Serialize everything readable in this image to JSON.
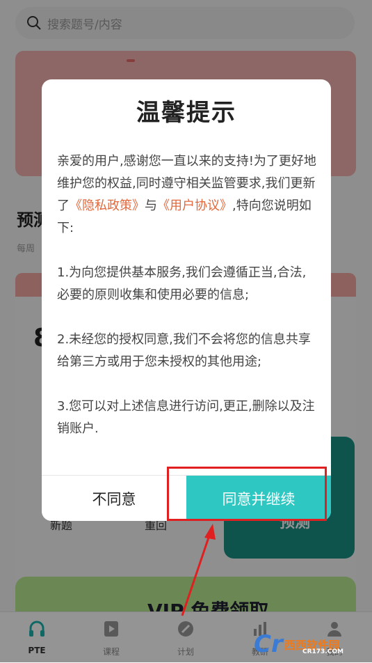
{
  "background": {
    "search_placeholder": "搜索题号/内容",
    "section_title": "预测",
    "section_sub": "每周",
    "card_number": "8",
    "label_new": "新题",
    "label_repeat": "重回",
    "teal_button": "预测",
    "vip_text": "VIP 免费领取"
  },
  "tabs": [
    {
      "label": "PTE",
      "icon": "headphones-icon"
    },
    {
      "label": "课程",
      "icon": "play-book-icon"
    },
    {
      "label": "计划",
      "icon": "pencil-icon"
    },
    {
      "label": "教研",
      "icon": "chart-icon"
    },
    {
      "label": "我的",
      "icon": "user-icon"
    }
  ],
  "dialog": {
    "title": "温馨提示",
    "p1_a": "亲爱的用户,感谢您一直以来的支持!为了更好地维护您的权益,同时遵守相关监管要求,我们更新了",
    "privacy_link": "《隐私政策》",
    "p1_b": "与",
    "agreement_link": "《用户协议》",
    "p1_c": ",特向您说明如下:",
    "p2": "1.为向您提供基本服务,我们会遵循正当,合法,必要的原则收集和使用必要的信息;",
    "p3": "2.未经您的授权同意,我们不会将您的信息共享给第三方或用于您未授权的其他用途;",
    "p4": "3.您可以对上述信息进行访问,更正,删除以及注销账户.",
    "disagree_label": "不同意",
    "agree_label": "同意并继续"
  },
  "colors": {
    "accent": "#2fc7c1",
    "link": "#e2683c",
    "highlight": "#e02020"
  },
  "watermark": {
    "logo": "Cr",
    "name": "西西软件园",
    "site": "CR173.COM"
  }
}
